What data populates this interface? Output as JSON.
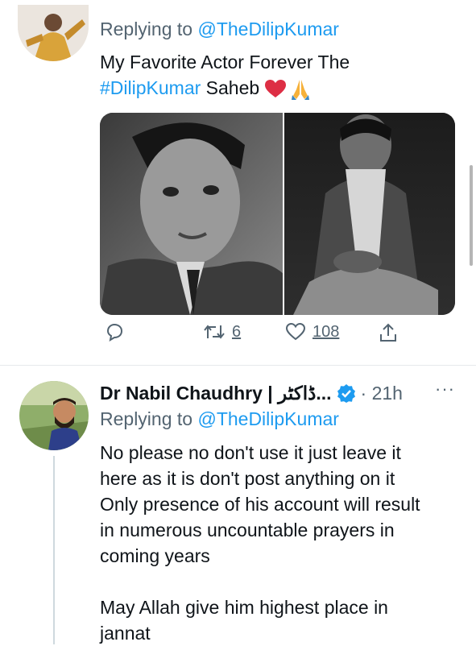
{
  "tweet1": {
    "replying_prefix": "Replying to ",
    "replying_handle": "@TheDilipKumar",
    "text_line1": "My Favorite Actor Forever The",
    "hashtag": "#DilipKumar",
    "text_line2_rest": " Saheb",
    "emoji": "❤️🙏",
    "actions": {
      "reply_count": "",
      "retweet_count": "6",
      "like_count": "108"
    }
  },
  "tweet2": {
    "author_name": "Dr Nabil Chaudhry | ڈاکٹر...",
    "time": "· 21h",
    "more_label": "···",
    "replying_prefix": "Replying to ",
    "replying_handle": "@TheDilipKumar",
    "paragraph1": [
      "No please no don't use it just leave it",
      "here as it is don't post anything on it",
      "Only presence of his account will result",
      "in numerous uncountable prayers in",
      "coming years"
    ],
    "paragraph2": [
      "May Allah give him highest place in",
      "jannat"
    ]
  },
  "colors": {
    "accent": "#1d9bf0",
    "secondary_text": "#536471",
    "verified": "#1d9bf0"
  }
}
